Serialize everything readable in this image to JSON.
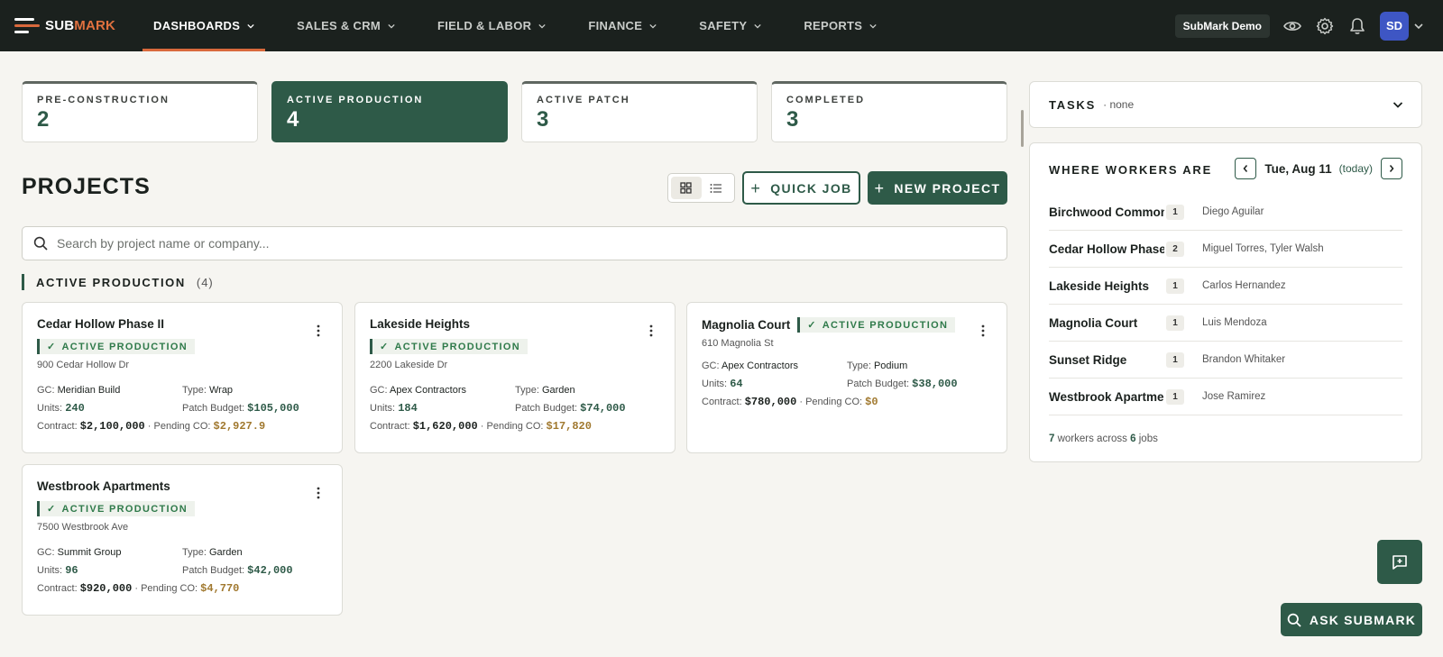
{
  "app": {
    "logo_primary": "SUB",
    "logo_accent": "MARK",
    "brand_color": "#2e5a48",
    "accent_color": "#d9693c"
  },
  "nav": {
    "items": [
      {
        "label": "DASHBOARDS",
        "active": true
      },
      {
        "label": "SALES & CRM"
      },
      {
        "label": "FIELD & LABOR"
      },
      {
        "label": "FINANCE"
      },
      {
        "label": "SAFETY"
      },
      {
        "label": "REPORTS"
      }
    ],
    "demo_label": "SubMark Demo",
    "avatar_initials": "SD"
  },
  "stats": [
    {
      "label": "PRE-CONSTRUCTION",
      "value": "2"
    },
    {
      "label": "ACTIVE PRODUCTION",
      "value": "4",
      "active": true
    },
    {
      "label": "ACTIVE PATCH",
      "value": "3"
    },
    {
      "label": "COMPLETED",
      "value": "3"
    }
  ],
  "projects": {
    "title": "PROJECTS",
    "quick_job_label": "QUICK JOB",
    "new_project_label": "NEW PROJECT",
    "search_placeholder": "Search by project name or company...",
    "section_label": "ACTIVE PRODUCTION",
    "section_count": "(4)",
    "labels": {
      "gc": "GC:",
      "units": "Units:",
      "type": "Type:",
      "patch_budget": "Patch Budget:",
      "contract": "Contract:",
      "pending_co": "· Pending CO:"
    },
    "cards": [
      {
        "name": "Cedar Hollow Phase II",
        "status": "ACTIVE PRODUCTION",
        "address": "900 Cedar Hollow Dr",
        "gc": "Meridian Build",
        "units": "240",
        "type": "Wrap",
        "patch_budget": "$105,000",
        "contract": "$2,100,000",
        "pending_co": "$2,927.9"
      },
      {
        "name": "Lakeside Heights",
        "status": "ACTIVE PRODUCTION",
        "address": "2200 Lakeside Dr",
        "gc": "Apex Contractors",
        "units": "184",
        "type": "Garden",
        "patch_budget": "$74,000",
        "contract": "$1,620,000",
        "pending_co": "$17,820"
      },
      {
        "name": "Magnolia Court",
        "status": "ACTIVE PRODUCTION",
        "address": "610 Magnolia St",
        "gc": "Apex Contractors",
        "units": "64",
        "type": "Podium",
        "patch_budget": "$38,000",
        "contract": "$780,000",
        "pending_co": "$0"
      },
      {
        "name": "Westbrook Apartments",
        "status": "ACTIVE PRODUCTION",
        "address": "7500 Westbrook Ave",
        "gc": "Summit Group",
        "units": "96",
        "type": "Garden",
        "patch_budget": "$42,000",
        "contract": "$920,000",
        "pending_co": "$4,770"
      }
    ]
  },
  "tasks": {
    "title": "TASKS",
    "subtitle": "· none"
  },
  "workers": {
    "title": "WHERE WORKERS ARE",
    "date": "Tue, Aug 11",
    "today_label": "(today)",
    "rows": [
      {
        "job": "Birchwood Commons",
        "count": "1",
        "people": "Diego Aguilar"
      },
      {
        "job": "Cedar Hollow Phase II",
        "count": "2",
        "people": "Miguel Torres, Tyler Walsh"
      },
      {
        "job": "Lakeside Heights",
        "count": "1",
        "people": "Carlos Hernandez"
      },
      {
        "job": "Magnolia Court",
        "count": "1",
        "people": "Luis Mendoza"
      },
      {
        "job": "Sunset Ridge",
        "count": "1",
        "people": "Brandon Whitaker"
      },
      {
        "job": "Westbrook Apartments",
        "count": "1",
        "people": "Jose Ramirez"
      }
    ],
    "footer_workers": "7",
    "footer_mid": "workers across",
    "footer_jobs": "6",
    "footer_end": "jobs"
  },
  "ask_label": "ASK SUBMARK"
}
